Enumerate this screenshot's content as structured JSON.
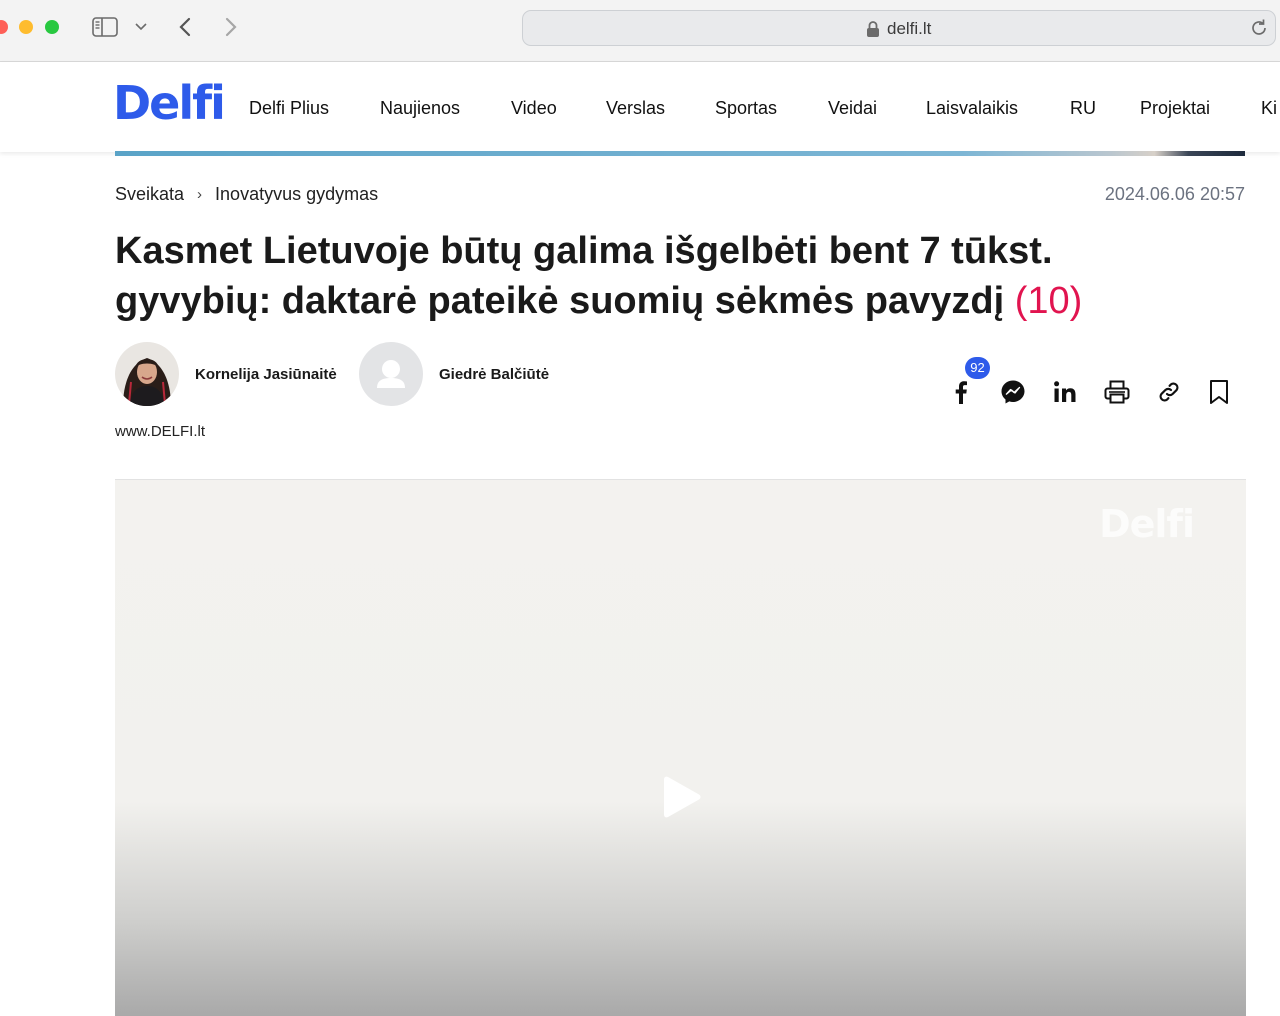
{
  "browser": {
    "url": "delfi.lt"
  },
  "header": {
    "logo": "Delfi",
    "nav": [
      "Delfi Plius",
      "Naujienos",
      "Video",
      "Verslas",
      "Sportas",
      "Veidai",
      "Laisvalaikis",
      "RU",
      "Projektai",
      "Ki"
    ]
  },
  "article": {
    "breadcrumb": [
      "Sveikata",
      "Inovatyvus gydymas"
    ],
    "breadcrumb_separator": "›",
    "date": "2024.06.06 20:57",
    "title": "Kasmet Lietuvoje būtų galima išgelbėti bent 7 tūkst. gyvybių: daktarė pateikė suomių sėkmės pavyzdį",
    "comment_count": "(10)",
    "authors": [
      {
        "name": "Kornelija Jasiūnaitė"
      },
      {
        "name": "Giedrė Balčiūtė"
      }
    ],
    "source": "www.DELFI.lt"
  },
  "share": {
    "facebook_count": "92",
    "icons": [
      "facebook-icon",
      "messenger-icon",
      "linkedin-icon",
      "print-icon",
      "link-icon",
      "bookmark-icon"
    ]
  },
  "video": {
    "watermark": "Delfi"
  },
  "colors": {
    "brand": "#2e5bea",
    "comment_count": "#e1144f",
    "date": "#6b7280"
  }
}
